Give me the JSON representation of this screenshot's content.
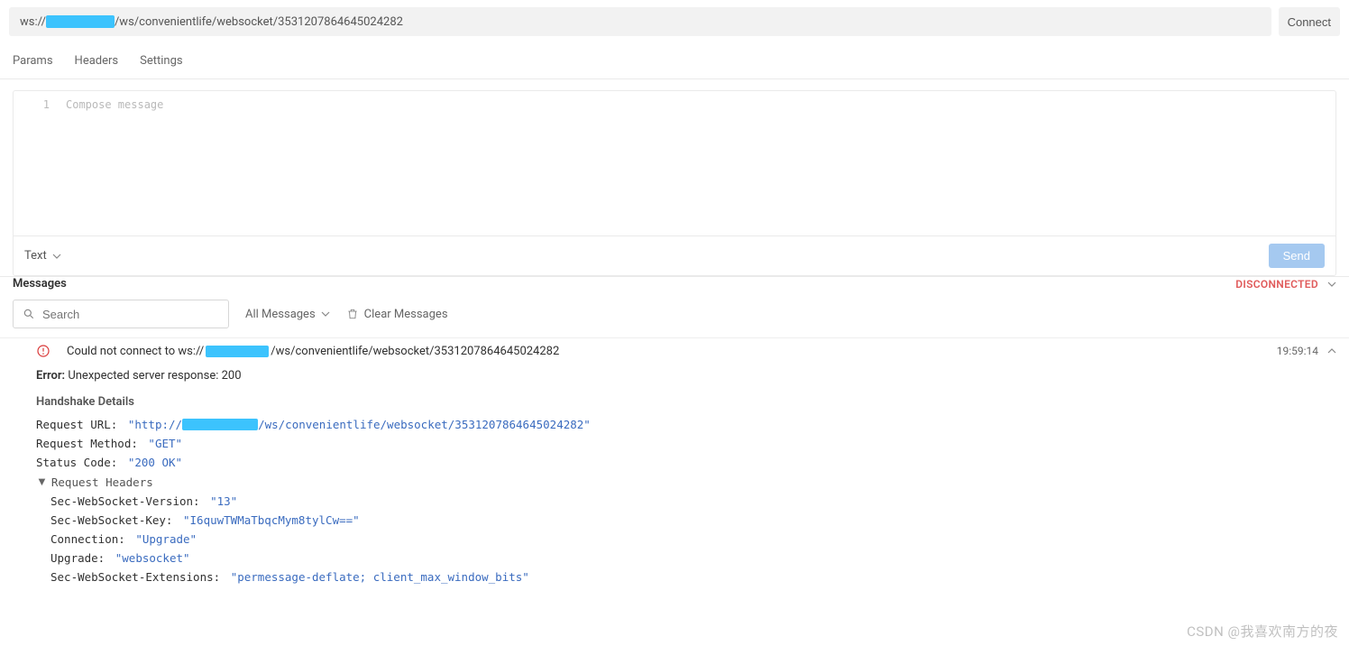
{
  "top": {
    "url_prefix": "ws://",
    "url_suffix": "/ws/convenientlife/websocket/3531207864645024282",
    "connect": "Connect"
  },
  "tabs": {
    "params": "Params",
    "headers": "Headers",
    "settings": "Settings"
  },
  "compose": {
    "line_num": "1",
    "placeholder": "Compose message",
    "type_label": "Text",
    "send": "Send"
  },
  "messages": {
    "title": "Messages",
    "status": "DISCONNECTED",
    "search_placeholder": "Search",
    "filter": "All Messages",
    "clear": "Clear Messages"
  },
  "log": {
    "prefix": "Could not connect to ws://",
    "suffix": "/ws/convenientlife/websocket/3531207864645024282",
    "time": "19:59:14"
  },
  "details": {
    "error_label": "Error:",
    "error_msg": " Unexpected server response: 200",
    "hs_title": "Handshake Details",
    "req_url_label": "Request URL:",
    "req_url_prefix": "\"http://",
    "req_url_suffix": "/ws/convenientlife/websocket/3531207864645024282\"",
    "req_method_label": "Request Method:",
    "req_method_val": "\"GET\"",
    "status_code_label": "Status Code:",
    "status_code_val": "\"200 OK\"",
    "req_headers_label": "Request Headers",
    "headers": {
      "ver_label": "Sec-WebSocket-Version:",
      "ver_val": "\"13\"",
      "key_label": "Sec-WebSocket-Key:",
      "key_val": "\"I6quwTWMaTbqcMym8tylCw==\"",
      "conn_label": "Connection:",
      "conn_val": "\"Upgrade\"",
      "upg_label": "Upgrade:",
      "upg_val": "\"websocket\"",
      "ext_label": "Sec-WebSocket-Extensions:",
      "ext_val": "\"permessage-deflate; client_max_window_bits\""
    }
  },
  "watermark": "CSDN @我喜欢南方的夜"
}
